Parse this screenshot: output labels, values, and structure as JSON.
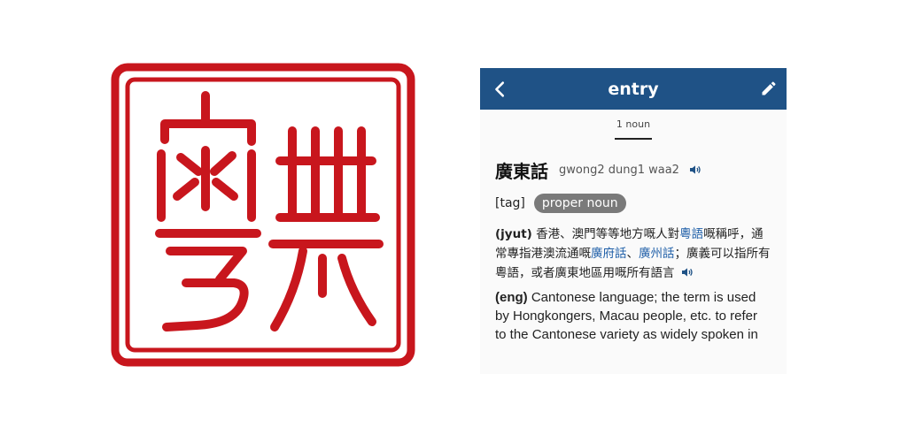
{
  "logo": {
    "seal_text": "粵典",
    "color": "#c8161d"
  },
  "header": {
    "title": "entry",
    "back_icon": "chevron-left-icon",
    "edit_icon": "pencil-icon",
    "bg": "#1f5286"
  },
  "tabs": [
    {
      "label": "1 noun"
    }
  ],
  "entry": {
    "headword": "廣東話",
    "jyutping": "gwong2 dung1 waa2",
    "tag_label": "[tag]",
    "tag_value": "proper noun",
    "jyut": {
      "lang": "(jyut)",
      "t1": " 香港、澳門等等地方嘅人對",
      "link1": "粵語",
      "t2": "嘅稱呼，通常專指港澳流通嘅",
      "link2": "廣府話",
      "t3": "、",
      "link3": "廣州話",
      "t4": "；廣義可以指所有粵語，或者廣東地區用嘅所有語言"
    },
    "eng": {
      "lang": "(eng)",
      "text": " Cantonese language; the term is used by Hongkongers, Macau people, etc. to refer to the Cantonese variety as widely spoken in"
    }
  }
}
